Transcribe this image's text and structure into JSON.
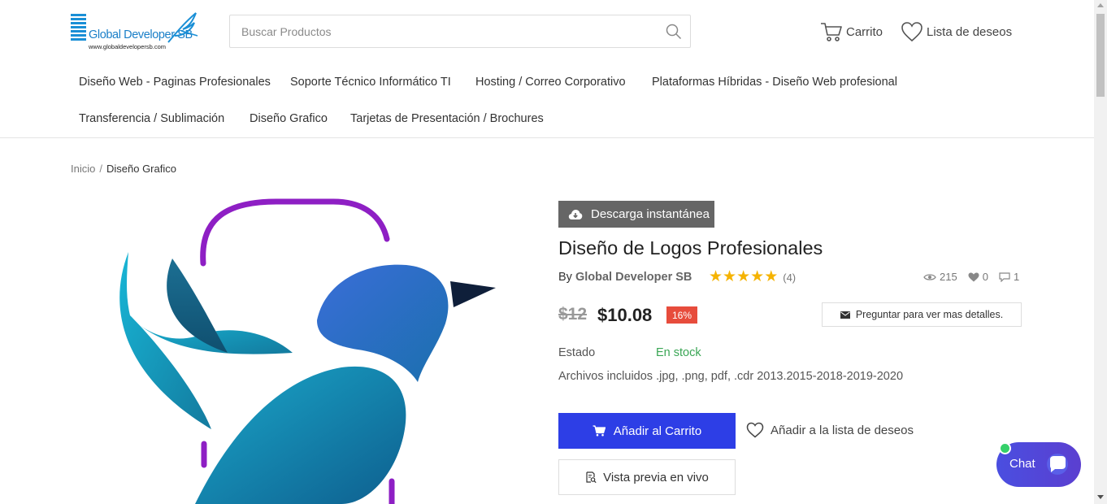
{
  "header": {
    "logo": {
      "name": "Global Developer SB",
      "url": "www.globaldevelopersb.com"
    },
    "search": {
      "placeholder": "Buscar Productos",
      "value": ""
    },
    "cart_label": "Carrito",
    "wishlist_label": "Lista de deseos"
  },
  "nav": {
    "items": [
      {
        "label": "Diseño Web - Paginas Profesionales"
      },
      {
        "label": "Soporte Técnico Informático TI"
      },
      {
        "label": "Hosting / Correo Corporativo"
      },
      {
        "label": "Plataformas Híbridas - Diseño Web profesional"
      },
      {
        "label": "Transferencia / Sublimación"
      },
      {
        "label": "Diseño Grafico"
      },
      {
        "label": "Tarjetas de Presentación / Brochures"
      }
    ]
  },
  "breadcrumb": {
    "home": "Inicio",
    "separator": "/",
    "current": "Diseño Grafico"
  },
  "product": {
    "badge": "Descarga instantánea",
    "title": "Diseño de Logos Profesionales",
    "by_label": "By",
    "author": "Global Developer SB",
    "rating": 5,
    "rating_count": "(4)",
    "views": "215",
    "likes": "0",
    "comments": "1",
    "old_price": "$12",
    "price": "$10.08",
    "discount": "16%",
    "ask_label": "Preguntar para ver mas detalles.",
    "state_label": "Estado",
    "state_value": "En stock",
    "files_text": "Archivos incluidos .jpg, .png, pdf, .cdr 2013.2015-2018-2019-2020",
    "add_to_cart_label": "Añadir al Carrito",
    "add_to_wishlist_label": "Añadir a la lista de deseos",
    "preview_label": "Vista previa en vivo"
  },
  "chat": {
    "label": "Chat",
    "online": true
  },
  "colors": {
    "primary_button": "#2d3ee6",
    "discount_badge": "#e74c3c",
    "in_stock": "#3aa655",
    "star": "#f5b301",
    "logo_blue": "#1a8fd6"
  }
}
